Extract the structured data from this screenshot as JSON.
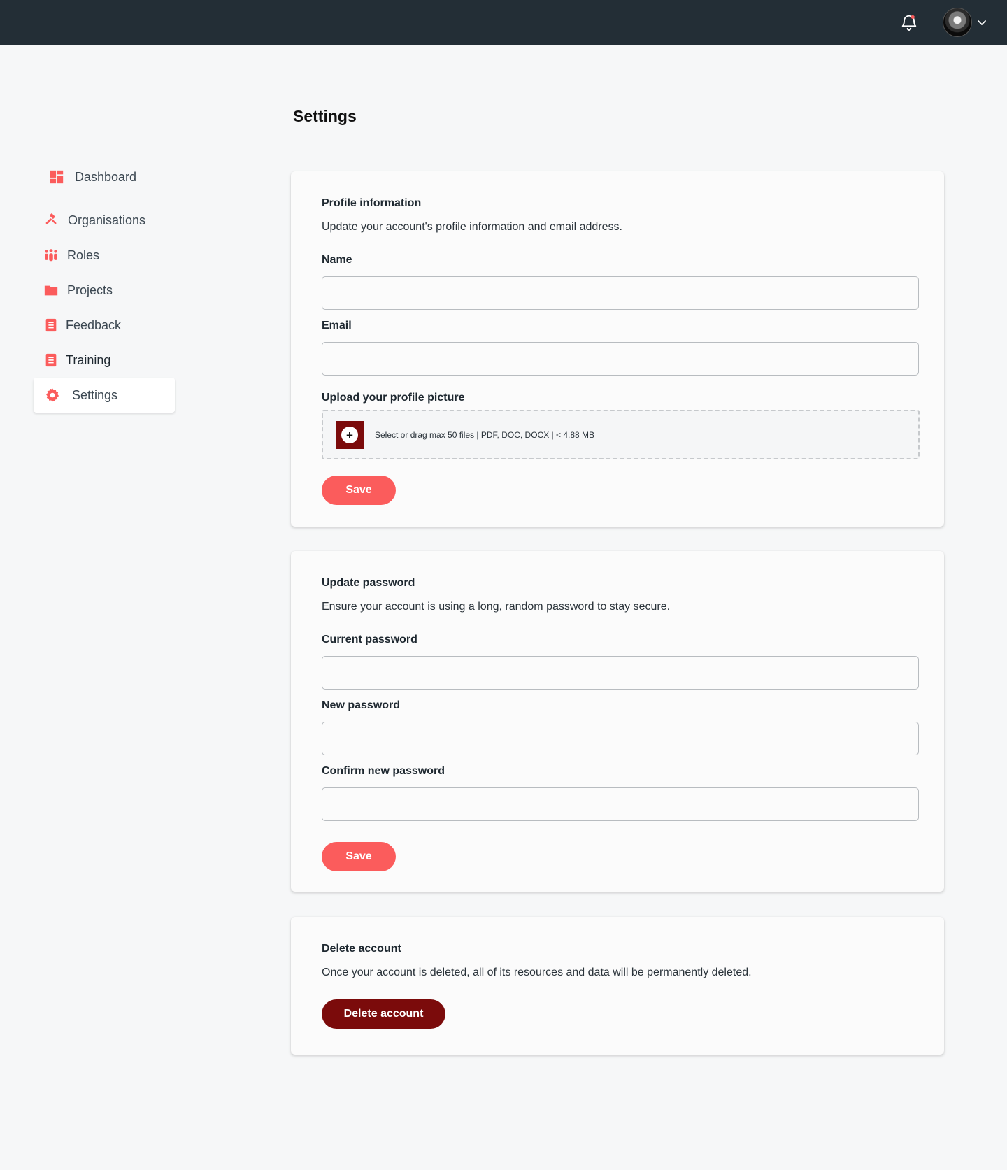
{
  "colors": {
    "topbar": "#232e36",
    "accent": "#fb5c5c",
    "danger": "#7b0b0b",
    "background": "#f6f7f8"
  },
  "header": {
    "notification_icon": "bell-icon",
    "avatar_icon": "user-avatar",
    "menu_icon": "chevron-down-icon"
  },
  "sidebar": {
    "items": [
      {
        "label": "Dashboard",
        "icon": "dashboard-grid-icon"
      },
      {
        "label": "Organisations",
        "icon": "gavel-icon"
      },
      {
        "label": "Roles",
        "icon": "users-group-icon"
      },
      {
        "label": "Projects",
        "icon": "folder-icon"
      },
      {
        "label": "Feedback",
        "icon": "document-icon"
      },
      {
        "label": "Training",
        "icon": "document-icon"
      },
      {
        "label": "Settings",
        "icon": "gear-icon",
        "active": true
      }
    ]
  },
  "page": {
    "title": "Settings"
  },
  "profile": {
    "heading": "Profile information",
    "description": "Update your account's profile information and email address.",
    "name_label": "Name",
    "name_value": "",
    "email_label": "Email",
    "email_value": "",
    "upload_label": "Upload your profile picture",
    "upload_hint": "Select or drag max 50 files | PDF, DOC, DOCX | < 4.88 MB",
    "save_label": "Save"
  },
  "password": {
    "heading": "Update password",
    "description": "Ensure your account is using a long, random password to stay secure.",
    "current_label": "Current password",
    "new_label": "New password",
    "confirm_label": "Confirm new password",
    "save_label": "Save"
  },
  "delete": {
    "heading": "Delete account",
    "description": "Once your account is deleted, all of its resources and data will be permanently deleted.",
    "button_label": "Delete account"
  }
}
